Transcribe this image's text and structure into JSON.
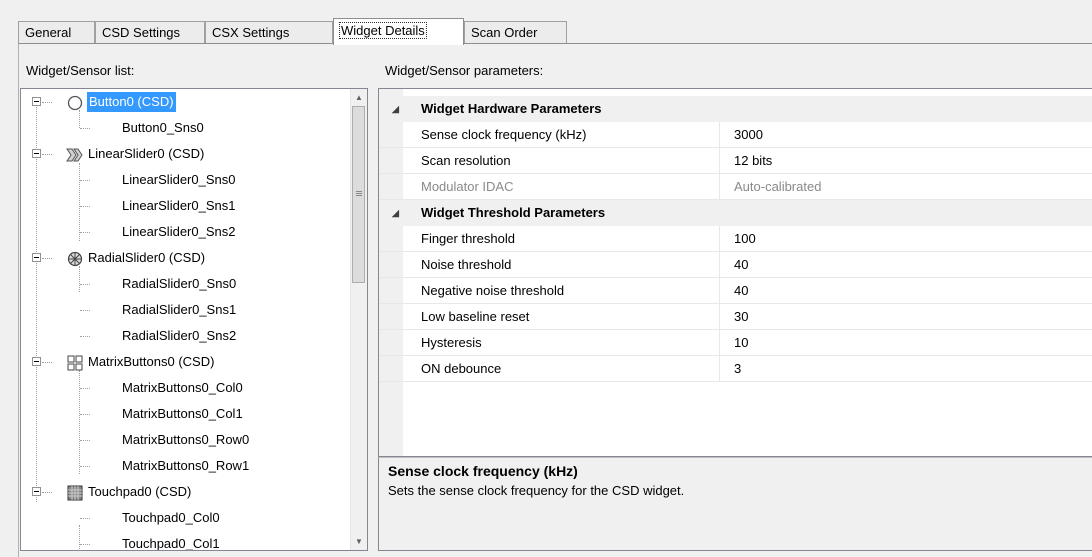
{
  "tabs": [
    {
      "label": "General"
    },
    {
      "label": "CSD Settings"
    },
    {
      "label": "CSX Settings"
    },
    {
      "label": "Widget Details"
    },
    {
      "label": "Scan Order"
    }
  ],
  "left_panel": {
    "heading": "Widget/Sensor list:"
  },
  "right_panel": {
    "heading": "Widget/Sensor parameters:"
  },
  "tree": {
    "nodes": [
      {
        "label": "Button0 (CSD)",
        "icon": "circle-icon",
        "type": "widget",
        "selected": true
      },
      {
        "label": "Button0_Sns0",
        "type": "sensor"
      },
      {
        "label": "LinearSlider0 (CSD)",
        "icon": "chevrons-icon",
        "type": "widget"
      },
      {
        "label": "LinearSlider0_Sns0",
        "type": "sensor"
      },
      {
        "label": "LinearSlider0_Sns1",
        "type": "sensor"
      },
      {
        "label": "LinearSlider0_Sns2",
        "type": "sensor"
      },
      {
        "label": "RadialSlider0 (CSD)",
        "icon": "radial-icon",
        "type": "widget"
      },
      {
        "label": "RadialSlider0_Sns0",
        "type": "sensor"
      },
      {
        "label": "RadialSlider0_Sns1",
        "type": "sensor"
      },
      {
        "label": "RadialSlider0_Sns2",
        "type": "sensor"
      },
      {
        "label": "MatrixButtons0 (CSD)",
        "icon": "matrix-grid-icon",
        "type": "widget"
      },
      {
        "label": "MatrixButtons0_Col0",
        "type": "sensor"
      },
      {
        "label": "MatrixButtons0_Col1",
        "type": "sensor"
      },
      {
        "label": "MatrixButtons0_Row0",
        "type": "sensor"
      },
      {
        "label": "MatrixButtons0_Row1",
        "type": "sensor"
      },
      {
        "label": "Touchpad0 (CSD)",
        "icon": "touchpad-icon",
        "type": "widget"
      },
      {
        "label": "Touchpad0_Col0",
        "type": "sensor"
      },
      {
        "label": "Touchpad0_Col1",
        "type": "sensor"
      }
    ]
  },
  "grid": {
    "categories": [
      {
        "name": "Widget Hardware Parameters",
        "props": [
          {
            "name": "Sense clock frequency (kHz)",
            "value": "3000"
          },
          {
            "name": "Scan resolution",
            "value": "12 bits"
          },
          {
            "name": "Modulator IDAC",
            "value": "Auto-calibrated",
            "disabled": true
          }
        ]
      },
      {
        "name": "Widget Threshold Parameters",
        "props": [
          {
            "name": "Finger threshold",
            "value": "100"
          },
          {
            "name": "Noise threshold",
            "value": "40"
          },
          {
            "name": "Negative noise threshold",
            "value": "40"
          },
          {
            "name": "Low baseline reset",
            "value": "30"
          },
          {
            "name": "Hysteresis",
            "value": "10"
          },
          {
            "name": "ON debounce",
            "value": "3"
          }
        ]
      }
    ]
  },
  "description": {
    "title": "Sense clock frequency (kHz)",
    "text": "Sets the sense clock frequency for the CSD widget."
  },
  "colors": {
    "selection": "#3399ff",
    "disabled_text": "#8a8a8a"
  }
}
